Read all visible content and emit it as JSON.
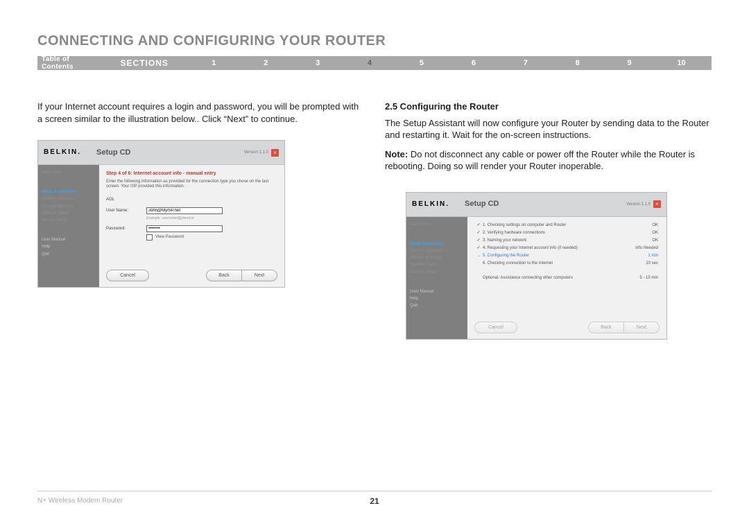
{
  "page_title": "CONNECTING AND CONFIGURING YOUR ROUTER",
  "nav": {
    "toc": "Table of Contents",
    "sections_label": "SECTIONS",
    "items": [
      "1",
      "2",
      "3",
      "4",
      "5",
      "6",
      "7",
      "8",
      "9",
      "10"
    ],
    "active_index": 3
  },
  "left": {
    "intro": "If your Internet account requires a login and password, you will be prompted with a screen similar to the illustration below.. Click “Next” to continue."
  },
  "right": {
    "heading": "2.5 Configuring the Router",
    "p1": "The Setup Assistant will now configure your Router by sending data to the Router and restarting it. Wait for the on-screen instructions.",
    "note_label": "Note:",
    "note": " Do not disconnect any cable or power off the Router while the Router is rebooting. Doing so will render your Router inoperable."
  },
  "shot_common": {
    "logo": "BELKIN.",
    "window_title": "Setup CD",
    "version": "Version 1.1.0",
    "close": "×",
    "sidebar": {
      "main_menu": "Main Menu",
      "setup_assistant": "Setup Assistant  ▸",
      "security_assistant": "Security Assistant",
      "storage_manager": "Storage Manager",
      "network_status": "Network Status",
      "manual_setup": "Manual Setup",
      "user_manual": "User Manual",
      "help": "Help",
      "quit": "Quit"
    },
    "buttons": {
      "cancel": "Cancel",
      "back": "Back",
      "next": "Next"
    }
  },
  "shot1": {
    "step_title": "Step 4 of 6: Internet account info - manual entry",
    "step_desc": "Enter the following information as provided for the connection type you chose on the last screen. Your ISP provided this information.",
    "isp": "AOL",
    "username_label": "User Name:",
    "username_value": "John@MyISP.net",
    "username_example": "Example: username@planet.nl",
    "password_label": "Password:",
    "password_value": "••••••••",
    "view_pw": "View Password"
  },
  "shot2": {
    "steps": [
      {
        "icon": "✓",
        "text": "1. Checking settings on computer and Router",
        "status": "OK"
      },
      {
        "icon": "✓",
        "text": "2. Verifying hardware connections",
        "status": "OK"
      },
      {
        "icon": "✓",
        "text": "3. Naming your network",
        "status": "OK"
      },
      {
        "icon": "✓",
        "text": "4. Requesting your Internet account info (if needed)",
        "status": "Info Needed"
      },
      {
        "icon": "→",
        "text": "5. Configuring the Router",
        "status": "1 min",
        "active": true
      },
      {
        "icon": "",
        "text": "6. Checking connection to the Internet",
        "status": "10 sec"
      }
    ],
    "optional": {
      "text": "Optional: Assistance connecting other computers",
      "status": "5 - 15 min"
    }
  },
  "footer": {
    "product": "N+ Wireless Modem Router",
    "page_number": "21"
  }
}
